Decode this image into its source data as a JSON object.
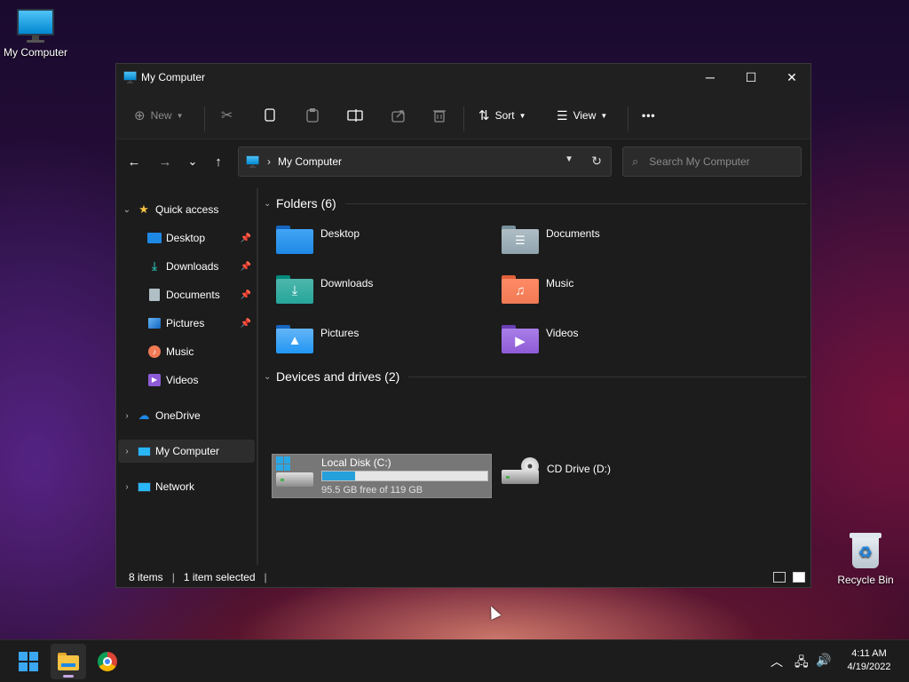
{
  "desktop": {
    "icons": [
      {
        "label": "My Computer",
        "icon": "monitor-icon"
      },
      {
        "label": "Recycle Bin",
        "icon": "recycle-bin-icon"
      }
    ]
  },
  "window": {
    "title": "My Computer",
    "controls": {
      "minimize": "─",
      "maximize": "☐",
      "close": "✕"
    }
  },
  "toolbar": {
    "new_label": "New",
    "sort_label": "Sort",
    "view_label": "View",
    "more_label": "•••"
  },
  "navbar": {
    "back": "←",
    "forward": "→",
    "recent": "⌄",
    "up": "↑",
    "address_crumb": "My Computer",
    "address_sep": "›",
    "search_placeholder": "Search My Computer"
  },
  "sidebar": {
    "items": [
      {
        "label": "Quick access",
        "icon": "star-icon",
        "expanded": true
      },
      {
        "label": "Desktop",
        "icon": "desktop-folder-icon",
        "pinned": true
      },
      {
        "label": "Downloads",
        "icon": "download-icon",
        "pinned": true
      },
      {
        "label": "Documents",
        "icon": "documents-icon",
        "pinned": true
      },
      {
        "label": "Pictures",
        "icon": "pictures-icon",
        "pinned": true
      },
      {
        "label": "Music",
        "icon": "music-icon",
        "pinned": false
      },
      {
        "label": "Videos",
        "icon": "videos-icon",
        "pinned": false
      },
      {
        "label": "OneDrive",
        "icon": "onedrive-icon",
        "expanded": false
      },
      {
        "label": "My Computer",
        "icon": "computer-icon",
        "expanded": false,
        "selected": true
      },
      {
        "label": "Network",
        "icon": "network-icon",
        "expanded": false
      }
    ]
  },
  "content": {
    "folders_heading": "Folders (6)",
    "folders": [
      {
        "label": "Desktop",
        "color": "#1e88e5"
      },
      {
        "label": "Documents",
        "color": "#90a4ae"
      },
      {
        "label": "Downloads",
        "color": "#26a69a"
      },
      {
        "label": "Music",
        "color": "#ef7a54"
      },
      {
        "label": "Pictures",
        "color": "#2196f3"
      },
      {
        "label": "Videos",
        "color": "#8e5bd6"
      }
    ],
    "drives_heading": "Devices and drives (2)",
    "drives": [
      {
        "label": "Local Disk (C:)",
        "free": "95.5 GB free of 119 GB",
        "used_fraction": 0.2,
        "selected": true
      },
      {
        "label": "CD Drive (D:)"
      }
    ]
  },
  "status": {
    "items": "8 items",
    "selected": "1 item selected"
  },
  "taskbar": {
    "time": "4:11 AM",
    "date": "4/19/2022"
  },
  "colors": {
    "accent": "#26a0da",
    "window_bg": "#1c1c1c",
    "selection": "#2d2d2d"
  }
}
